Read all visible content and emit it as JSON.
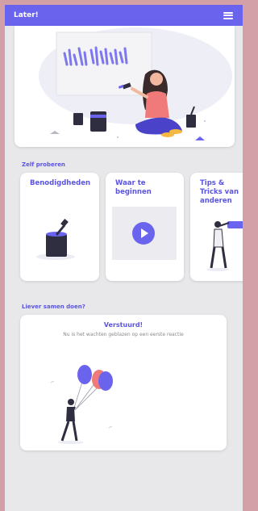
{
  "app": {
    "title": "Later!"
  },
  "icons": {
    "menu": "hamburger-menu-icon"
  },
  "colors": {
    "accent": "#6a63ee",
    "accent_text": "#5a54e0",
    "frame": "#d4a0a8",
    "background": "#e8e8ea"
  },
  "sections": {
    "try_yourself": {
      "title": "Zelf proberen",
      "cards": [
        {
          "title": "Benodigdheden"
        },
        {
          "title": "Waar te beginnen"
        },
        {
          "title": "Tips & Tricks van anderen"
        }
      ]
    },
    "together": {
      "title": "Liever samen doen?",
      "card": {
        "title": "Verstuurd!",
        "subtitle": "Nu is het wachten geblazen op een eerste reactie"
      }
    }
  }
}
